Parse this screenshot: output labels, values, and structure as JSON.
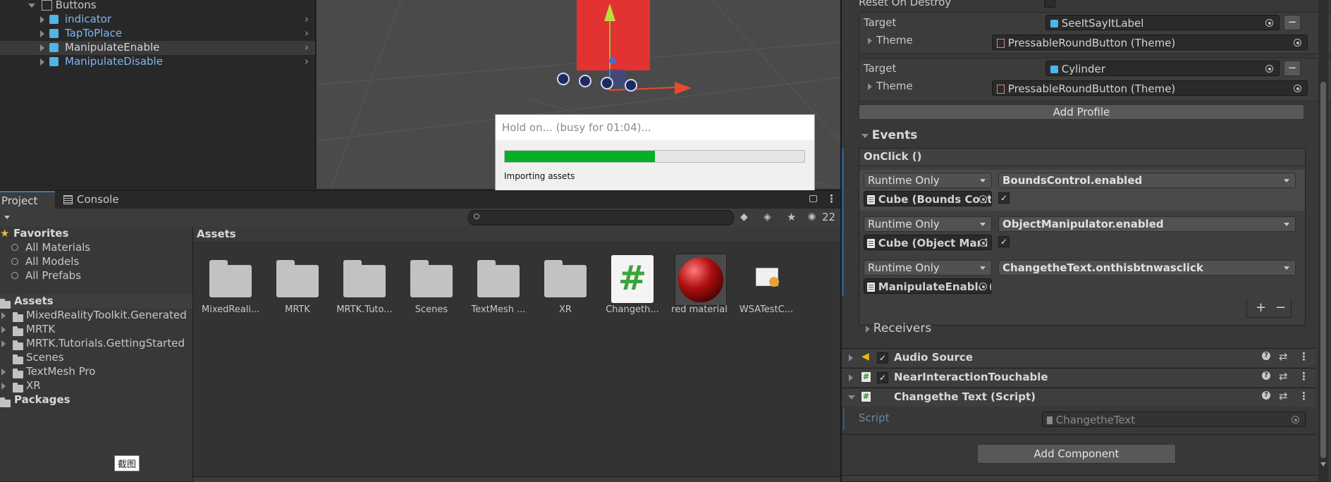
{
  "hierarchy": {
    "parent": "Buttons",
    "items": [
      {
        "label": "indicator"
      },
      {
        "label": "TapToPlace"
      },
      {
        "label": "ManipulateEnable"
      },
      {
        "label": "ManipulateDisable"
      }
    ]
  },
  "progress_dialog": {
    "title": "Hold on... (busy for 01:04)...",
    "status": "Importing assets",
    "progress": 0.5
  },
  "tabs": {
    "project": "Project",
    "console": "Console"
  },
  "toolbar": {
    "hidden_count": "22"
  },
  "project_tree": {
    "favorites_label": "Favorites",
    "favorites": [
      "All Materials",
      "All Models",
      "All Prefabs"
    ],
    "assets_label": "Assets",
    "assets": [
      "MixedRealityToolkit.Generated",
      "MRTK",
      "MRTK.Tutorials.GettingStarted",
      "Scenes",
      "TextMesh Pro",
      "XR"
    ],
    "packages_label": "Packages"
  },
  "assets_panel": {
    "header": "Assets",
    "items": [
      {
        "label": "MixedReali...",
        "kind": "folder"
      },
      {
        "label": "MRTK",
        "kind": "folder"
      },
      {
        "label": "MRTK.Tuto...",
        "kind": "folder"
      },
      {
        "label": "Scenes",
        "kind": "folder"
      },
      {
        "label": "TextMesh ...",
        "kind": "folder"
      },
      {
        "label": "XR",
        "kind": "folder"
      },
      {
        "label": "Changeth...",
        "kind": "script"
      },
      {
        "label": "red material",
        "kind": "material"
      },
      {
        "label": "WSATestC...",
        "kind": "certificate"
      }
    ]
  },
  "tooltip": "截图",
  "inspector": {
    "reset_on_destroy": "Reset On Destroy",
    "profiles": [
      {
        "target_label": "Target",
        "target_value": "SeeItSayItLabel",
        "theme_label": "Theme",
        "theme_value": "PressableRoundButton (Theme)"
      },
      {
        "target_label": "Target",
        "target_value": "Cylinder",
        "theme_label": "Theme",
        "theme_value": "PressableRoundButton (Theme)"
      }
    ],
    "add_profile": "Add Profile",
    "events_label": "Events",
    "onclick_label": "OnClick ()",
    "event_rows": [
      {
        "mode": "Runtime Only",
        "function": "BoundsControl.enabled",
        "object": "Cube (Bounds Cont",
        "checked": true
      },
      {
        "mode": "Runtime Only",
        "function": "ObjectManipulator.enabled",
        "object": "Cube (Object Mani",
        "checked": true
      },
      {
        "mode": "Runtime Only",
        "function": "ChangetheText.onthisbtnwasclick",
        "object": "ManipulateEnable (",
        "checked": false
      }
    ],
    "plus": "+",
    "minus": "−",
    "receivers_label": "Receivers",
    "components": [
      {
        "name": "Audio Source",
        "icon": "speaker-icon",
        "enabled": true
      },
      {
        "name": "NearInteractionTouchable",
        "icon": "script-icon",
        "enabled": true
      },
      {
        "name": "Changethe Text (Script)",
        "icon": "script-icon",
        "enabled": null
      }
    ],
    "script_label": "Script",
    "script_value": "ChangetheText",
    "add_component": "Add Component"
  },
  "colors": {
    "progress_green": "#06b025",
    "link_blue": "#7fb6f2",
    "scene_red": "#e23232"
  }
}
